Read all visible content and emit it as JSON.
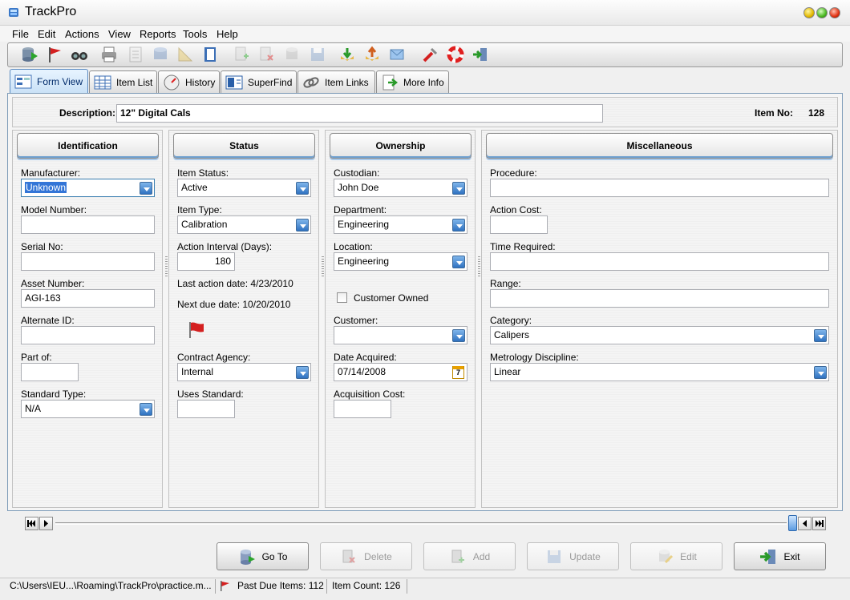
{
  "window": {
    "title": "TrackPro"
  },
  "menu": [
    "File",
    "Edit",
    "Actions",
    "View",
    "Reports",
    "Tools",
    "Help"
  ],
  "toolbar_icons": [
    "database-next-icon",
    "flag-icon",
    "binoculars-icon",
    "printer-icon",
    "report-icon",
    "cylinder-icon",
    "ruler-icon",
    "notebook-icon",
    "add-record-icon",
    "delete-record-icon",
    "database-icon",
    "save-icon",
    "download-icon",
    "export-icon",
    "mail-icon",
    "tools-icon",
    "lifebuoy-icon",
    "exit-icon"
  ],
  "tabs": [
    {
      "label": "Form View",
      "icon": "form-icon",
      "active": true
    },
    {
      "label": "Item List",
      "icon": "list-icon"
    },
    {
      "label": "History",
      "icon": "compass-icon"
    },
    {
      "label": "SuperFind",
      "icon": "find-icon"
    },
    {
      "label": "Item Links",
      "icon": "chain-icon"
    },
    {
      "label": "More Info",
      "icon": "page-arrow-icon"
    }
  ],
  "header": {
    "description_label": "Description:",
    "description_value": "12\" Digital Cals",
    "item_no_label": "Item No:",
    "item_no_value": "128"
  },
  "identification": {
    "title": "Identification",
    "manufacturer_label": "Manufacturer:",
    "manufacturer_value": "Unknown",
    "model_label": "Model Number:",
    "model_value": "",
    "serial_label": "Serial No:",
    "serial_value": "",
    "asset_label": "Asset Number:",
    "asset_value": "AGI-163",
    "alternate_label": "Alternate ID:",
    "alternate_value": "",
    "partof_label": "Part of:",
    "partof_value": "",
    "standard_label": "Standard Type:",
    "standard_value": "N/A"
  },
  "status": {
    "title": "Status",
    "item_status_label": "Item Status:",
    "item_status_value": "Active",
    "item_type_label": "Item Type:",
    "item_type_value": "Calibration",
    "interval_label": "Action Interval (Days):",
    "interval_value": "180",
    "last_action": "Last action date: 4/23/2010",
    "next_due": "Next due date: 10/20/2010",
    "agency_label": "Contract Agency:",
    "agency_value": "Internal",
    "uses_standard_label": "Uses Standard:",
    "uses_standard_value": ""
  },
  "ownership": {
    "title": "Ownership",
    "custodian_label": "Custodian:",
    "custodian_value": "John Doe",
    "department_label": "Department:",
    "department_value": "Engineering",
    "location_label": "Location:",
    "location_value": "Engineering",
    "customer_owned_label": "Customer Owned",
    "customer_owned": false,
    "customer_label": "Customer:",
    "customer_value": "",
    "date_acquired_label": "Date Acquired:",
    "date_acquired_value": "07/14/2008",
    "acq_cost_label": "Acquisition Cost:",
    "acq_cost_value": ""
  },
  "misc": {
    "title": "Miscellaneous",
    "procedure_label": "Procedure:",
    "procedure_value": "",
    "action_cost_label": "Action Cost:",
    "action_cost_value": "",
    "time_required_label": "Time Required:",
    "time_required_value": "",
    "range_label": "Range:",
    "range_value": "",
    "category_label": "Category:",
    "category_value": "Calipers",
    "discipline_label": "Metrology Discipline:",
    "discipline_value": "Linear"
  },
  "actions": {
    "goto": "Go To",
    "delete": "Delete",
    "add": "Add",
    "update": "Update",
    "edit": "Edit",
    "exit": "Exit"
  },
  "statusbar": {
    "path": "C:\\Users\\IEU...\\Roaming\\TrackPro\\practice.m...",
    "past_due": "Past Due Items: 112",
    "item_count": "Item Count: 126"
  },
  "colors": {
    "accent": "#2f72c0",
    "selection": "#3375d7",
    "flag": "#d42020"
  }
}
